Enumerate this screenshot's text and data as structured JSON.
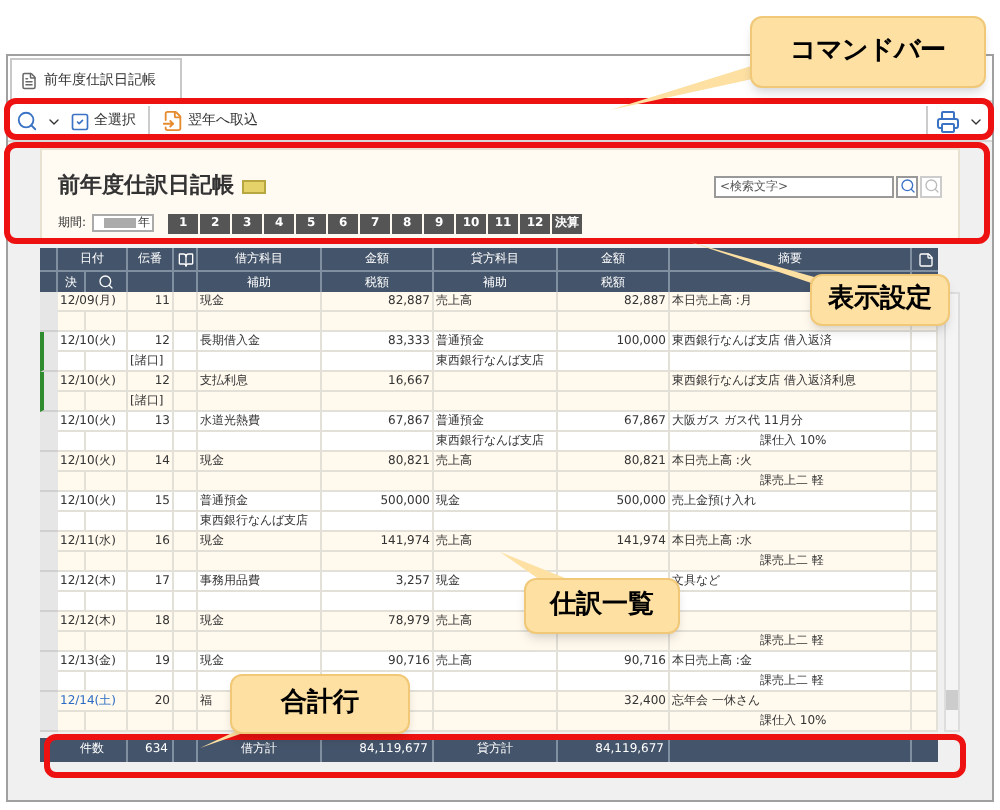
{
  "callouts": [
    {
      "kind": "command",
      "text": "コマンドバー"
    },
    {
      "kind": "display",
      "text": "表示設定"
    },
    {
      "kind": "list",
      "text": "仕訳一覧"
    },
    {
      "kind": "total",
      "text": "合計行"
    }
  ],
  "tab": {
    "label": "前年度仕訳日記帳"
  },
  "toolbar": {
    "select_all": "全選択",
    "import": "翌年へ取込"
  },
  "header": {
    "title": "前年度仕訳日記帳",
    "period_label": "期間:",
    "year_suffix": "年",
    "months": [
      "1",
      "2",
      "3",
      "4",
      "5",
      "6",
      "7",
      "8",
      "9",
      "10",
      "11",
      "12",
      "決算"
    ],
    "search": {
      "placeholder": "<検索文字>"
    }
  },
  "table": {
    "columns_top": [
      "日付",
      "伝番",
      "借方科目",
      "金額",
      "貸方科目",
      "金額",
      "摘要"
    ],
    "columns_bottom": [
      "決",
      "補助",
      "税額",
      "補助",
      "税額"
    ],
    "rows": [
      {
        "date": "12/09(月)",
        "color": "#333333",
        "selected": false,
        "no": "11",
        "no2": "",
        "debit": "現金",
        "debit_sub": "",
        "amount": "82,887",
        "tax": "",
        "credit": "売上高",
        "credit_sub": "",
        "credit_amount": "82,887",
        "credit_tax": "",
        "memo": "本日売上高 :月",
        "memo2": ""
      },
      {
        "date": "12/10(火)",
        "color": "#333333",
        "selected": true,
        "no": "12",
        "no2": "[諸口]",
        "debit": "長期借入金",
        "debit_sub": "",
        "amount": "83,333",
        "tax": "",
        "credit": "普通預金",
        "credit_sub": "東西銀行なんば支店",
        "credit_amount": "100,000",
        "credit_tax": "",
        "memo": "東西銀行なんば支店  借入返済",
        "memo2": ""
      },
      {
        "date": "12/10(火)",
        "color": "#333333",
        "selected": true,
        "no": "12",
        "no2": "[諸口]",
        "debit": "支払利息",
        "debit_sub": "",
        "amount": "16,667",
        "tax": "",
        "credit": "",
        "credit_sub": "",
        "credit_amount": "",
        "credit_tax": "",
        "memo": "東西銀行なんば支店  借入返済利息",
        "memo2": ""
      },
      {
        "date": "12/10(火)",
        "color": "#333333",
        "selected": false,
        "no": "13",
        "no2": "",
        "debit": "水道光熱費",
        "debit_sub": "",
        "amount": "67,867",
        "tax": "",
        "credit": "普通預金",
        "credit_sub": "東西銀行なんば支店",
        "credit_amount": "67,867",
        "credit_tax": "",
        "memo": "大阪ガス  ガス代  11月分",
        "memo2": "課仕入  10%"
      },
      {
        "date": "12/10(火)",
        "color": "#333333",
        "selected": false,
        "no": "14",
        "no2": "",
        "debit": "現金",
        "debit_sub": "",
        "amount": "80,821",
        "tax": "",
        "credit": "売上高",
        "credit_sub": "",
        "credit_amount": "80,821",
        "credit_tax": "",
        "memo": "本日売上高 :火",
        "memo2": "課売上二 軽"
      },
      {
        "date": "12/10(火)",
        "color": "#333333",
        "selected": false,
        "no": "15",
        "no2": "",
        "debit": "普通預金",
        "debit_sub": "東西銀行なんば支店",
        "amount": "500,000",
        "tax": "",
        "credit": "現金",
        "credit_sub": "",
        "credit_amount": "500,000",
        "credit_tax": "",
        "memo": "売上金預け入れ",
        "memo2": ""
      },
      {
        "date": "12/11(水)",
        "color": "#333333",
        "selected": false,
        "no": "16",
        "no2": "",
        "debit": "現金",
        "debit_sub": "",
        "amount": "141,974",
        "tax": "",
        "credit": "売上高",
        "credit_sub": "",
        "credit_amount": "141,974",
        "credit_tax": "",
        "memo": "本日売上高 :水",
        "memo2": "課売上二 軽"
      },
      {
        "date": "12/12(木)",
        "color": "#333333",
        "selected": false,
        "no": "17",
        "no2": "",
        "debit": "事務用品費",
        "debit_sub": "",
        "amount": "3,257",
        "tax": "",
        "credit": "現金",
        "credit_sub": "",
        "credit_amount": "",
        "credit_tax": "",
        "memo": "文具など",
        "memo2": ""
      },
      {
        "date": "12/12(木)",
        "color": "#333333",
        "selected": false,
        "no": "18",
        "no2": "",
        "debit": "現金",
        "debit_sub": "",
        "amount": "78,979",
        "tax": "",
        "credit": "売上高",
        "credit_sub": "",
        "credit_amount": "",
        "credit_tax": "",
        "memo": "",
        "memo2": "課売上二 軽"
      },
      {
        "date": "12/13(金)",
        "color": "#333333",
        "selected": false,
        "no": "19",
        "no2": "",
        "debit": "現金",
        "debit_sub": "",
        "amount": "90,716",
        "tax": "",
        "credit": "売上高",
        "credit_sub": "",
        "credit_amount": "90,716",
        "credit_tax": "",
        "memo": "本日売上高 :金",
        "memo2": "課売上二 軽"
      },
      {
        "date": "12/14(土)",
        "color": "#2a6cc4",
        "selected": false,
        "no": "20",
        "no2": "",
        "debit": "福",
        "debit_sub": "",
        "amount": "",
        "tax": "",
        "credit": "",
        "credit_sub": "",
        "credit_amount": "32,400",
        "credit_tax": "",
        "memo": "忘年会  一休さん",
        "memo2": "課仕入  10%"
      }
    ],
    "footer": {
      "count_label": "件数",
      "count": "634",
      "debit_label": "借方計",
      "debit_total": "84,119,677",
      "credit_label": "貸方計",
      "credit_total": "84,119,677"
    }
  }
}
